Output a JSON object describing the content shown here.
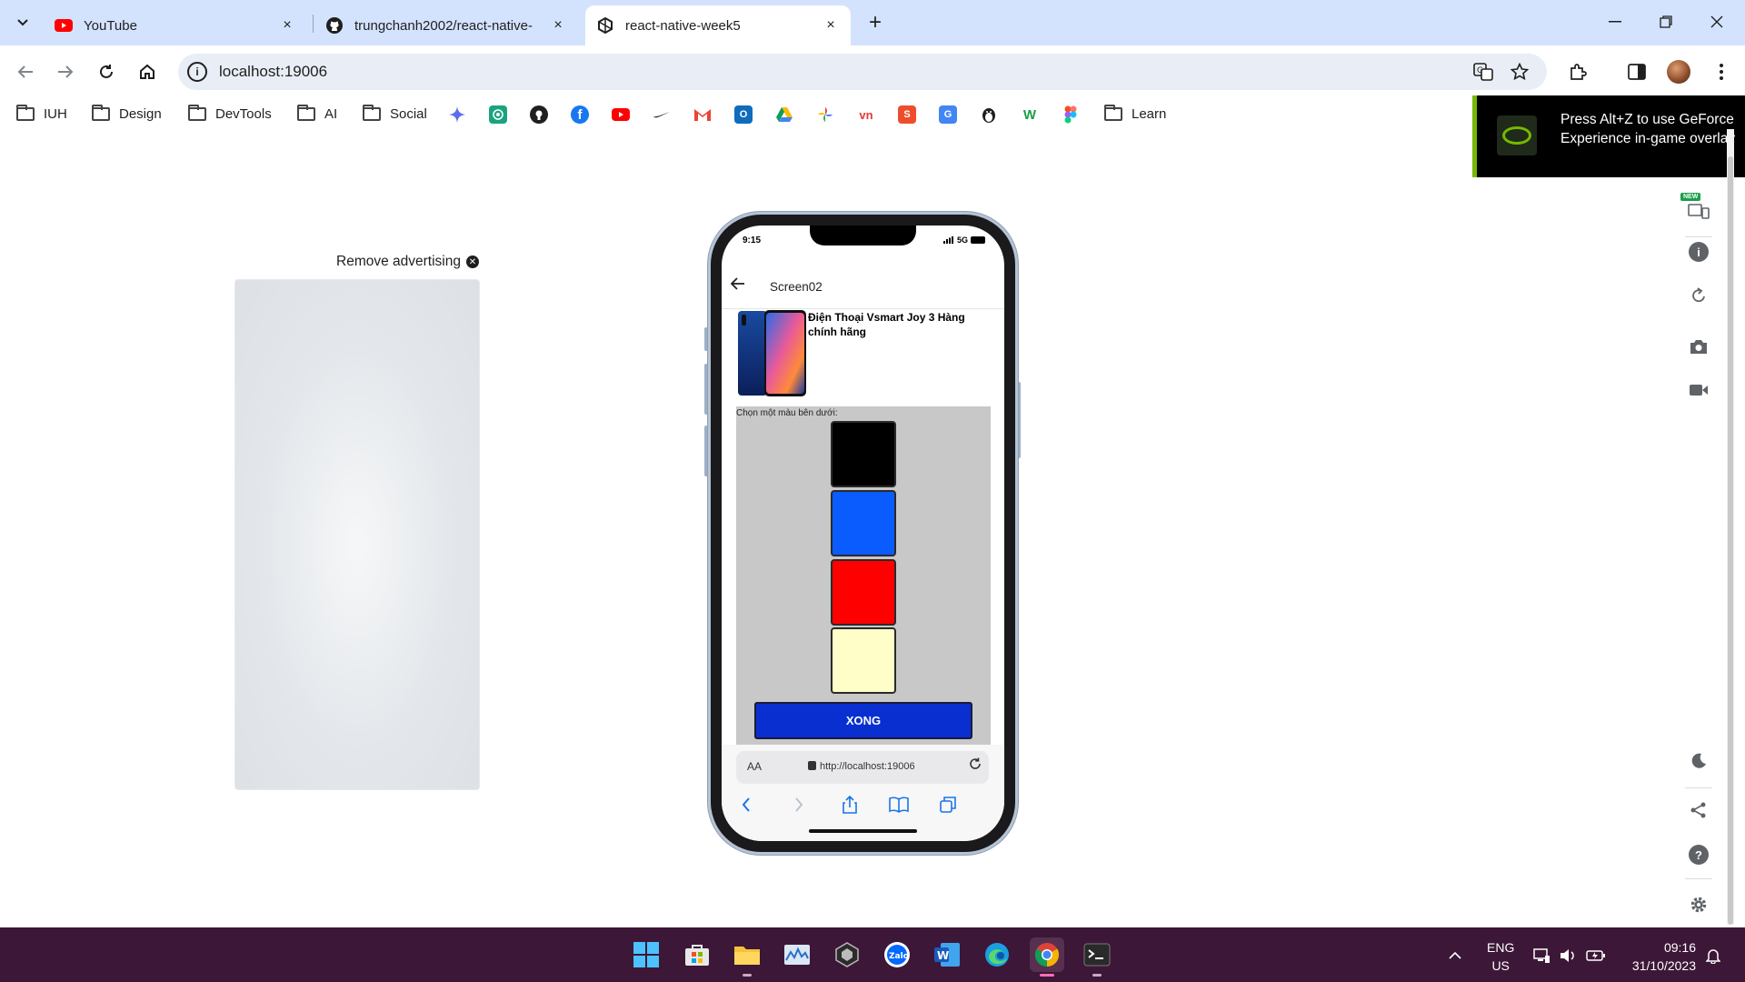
{
  "browser": {
    "tabs": [
      {
        "title": "YouTube",
        "active": false,
        "favicon": "youtube-icon",
        "color": "#ff0000"
      },
      {
        "title": "trungchanh2002/react-native-",
        "active": false,
        "favicon": "github-icon",
        "color": "#1f1f1f"
      },
      {
        "title": "react-native-week5",
        "active": true,
        "favicon": "expo-icon",
        "color": "#1f1f1f"
      }
    ],
    "close_glyph": "×",
    "new_tab_glyph": "+",
    "address": "localhost:19006",
    "bookmarks": [
      {
        "label": "IUH",
        "type": "folder"
      },
      {
        "label": "Design",
        "type": "folder"
      },
      {
        "label": "DevTools",
        "type": "folder"
      },
      {
        "label": "AI",
        "type": "folder"
      },
      {
        "label": "Social",
        "type": "folder"
      },
      {
        "label": "Learn",
        "type": "folder"
      }
    ]
  },
  "overlay": {
    "message": "Press Alt+Z to use GeForce Experience in-game overlay",
    "accent": "#76b900"
  },
  "ad": {
    "remove_label": "Remove advertising"
  },
  "phone": {
    "status_time": "9:15",
    "network": "5G",
    "header_title": "Screen02",
    "product_name": "Điện Thoại Vsmart Joy 3 Hàng chính hãng",
    "choose_label": "Chọn một màu bên dưới:",
    "swatches": [
      {
        "name": "black",
        "color": "#000000"
      },
      {
        "name": "blue",
        "color": "#0a5cff"
      },
      {
        "name": "red",
        "color": "#ff0000"
      },
      {
        "name": "cream",
        "color": "#fffec8"
      }
    ],
    "done_label": "XONG",
    "safari": {
      "text_size_label": "AA",
      "url": "http://localhost:19006"
    }
  },
  "side_panel": {
    "new_badge": "NEW"
  },
  "taskbar": {
    "lang_top": "ENG",
    "lang_bottom": "US",
    "time": "09:16",
    "date": "31/10/2023"
  }
}
